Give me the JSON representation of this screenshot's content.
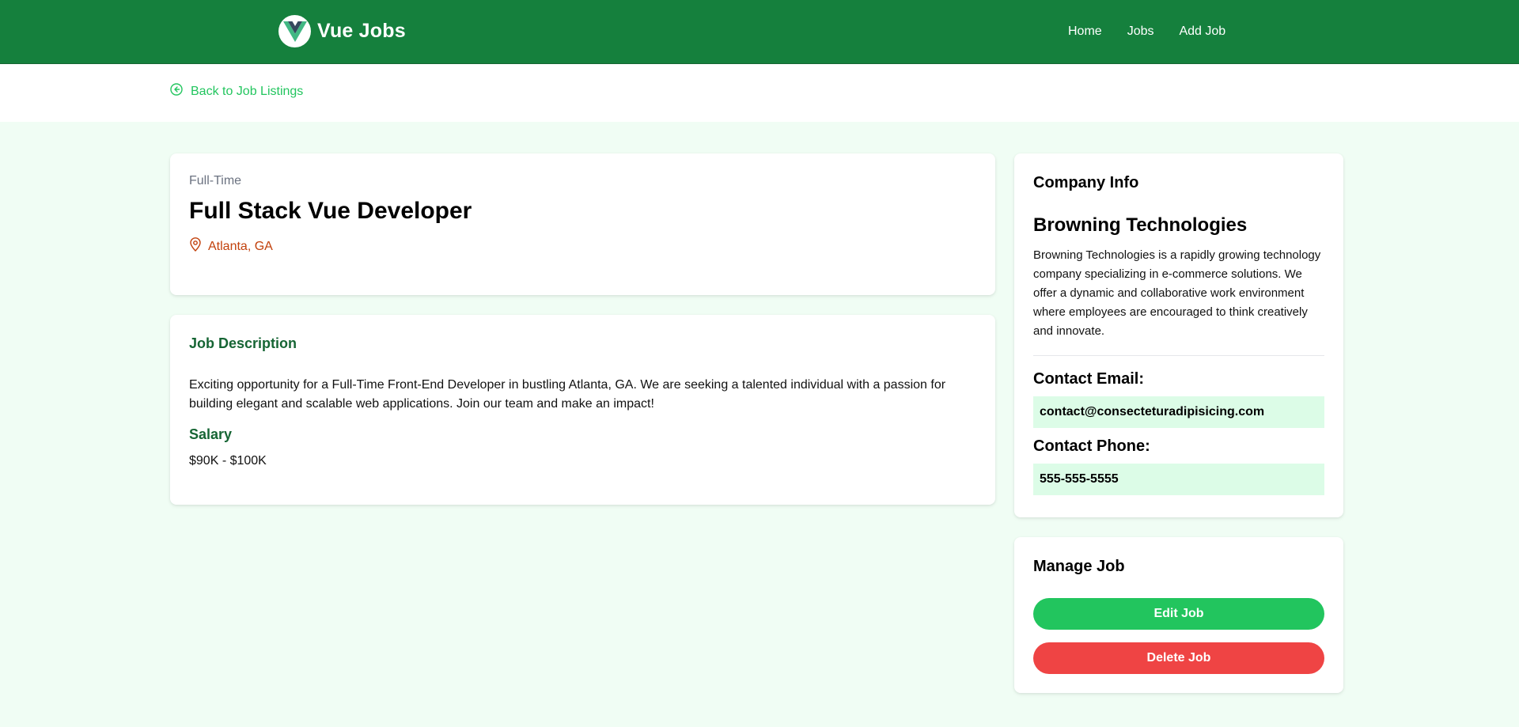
{
  "nav": {
    "brand": "Vue Jobs",
    "links": [
      "Home",
      "Jobs",
      "Add Job"
    ]
  },
  "back": {
    "label": "Back to Job Listings"
  },
  "job": {
    "type": "Full-Time",
    "title": "Full Stack Vue Developer",
    "location": "Atlanta, GA",
    "description_title": "Job Description",
    "description": "Exciting opportunity for a Full-Time Front-End Developer in bustling Atlanta, GA. We are seeking a talented individual with a passion for building elegant and scalable web applications. Join our team and make an impact!",
    "salary_title": "Salary",
    "salary": "$90K - $100K"
  },
  "company": {
    "section_title": "Company Info",
    "name": "Browning Technologies",
    "description": "Browning Technologies is a rapidly growing technology company specializing in e-commerce solutions. We offer a dynamic and collaborative work environment where employees are encouraged to think creatively and innovate.",
    "email_label": "Contact Email:",
    "email": "contact@consecteturadipisicing.com",
    "phone_label": "Contact Phone:",
    "phone": "555-555-5555"
  },
  "manage": {
    "title": "Manage Job",
    "edit_label": "Edit Job",
    "delete_label": "Delete Job"
  },
  "colors": {
    "nav_bg": "#15803d",
    "page_bg": "#f0fdf4",
    "accent": "#22c55e",
    "danger": "#ef4444",
    "location": "#c2410c",
    "heading_green": "#166534"
  },
  "icons": [
    "vue-logo-icon",
    "arrow-left-circle-icon",
    "map-marker-icon"
  ]
}
